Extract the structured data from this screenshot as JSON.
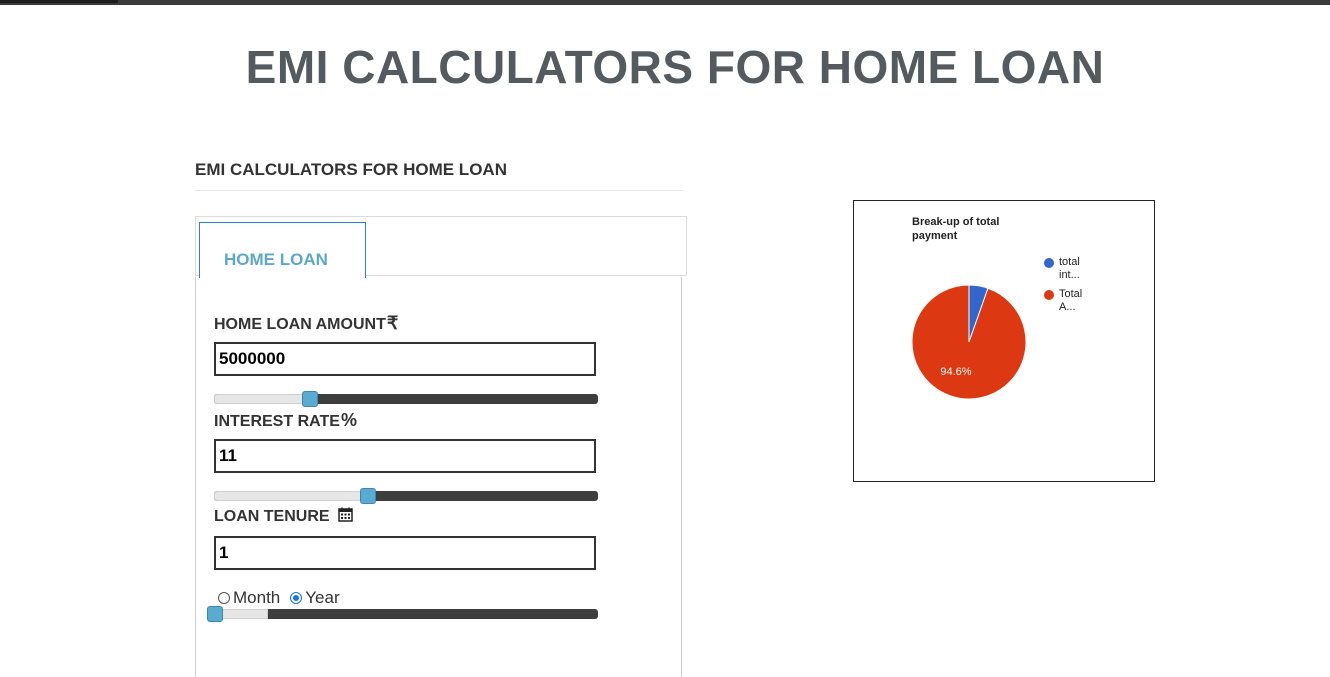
{
  "header": {
    "title": "EMI CALCULATORS FOR HOME LOAN"
  },
  "section": {
    "title": "EMI CALCULATORS FOR HOME LOAN"
  },
  "tabs": [
    {
      "label": "HOME LOAN",
      "active": true
    }
  ],
  "form": {
    "amount": {
      "label": "HOME LOAN AMOUNT",
      "symbol": "₹",
      "value": "5000000",
      "slider_fraction": 0.25
    },
    "rate": {
      "label": "INTEREST RATE",
      "symbol": "%",
      "value": "11",
      "slider_fraction": 0.4
    },
    "tenure": {
      "label": "LOAN TENURE",
      "icon": "calendar-icon",
      "value": "1",
      "slider_fraction": 0.0,
      "units": [
        {
          "label": "Month",
          "checked": false
        },
        {
          "label": "Year",
          "checked": true
        }
      ]
    }
  },
  "colors": {
    "accent": "#5ea8c7",
    "slider_thumb": "#5aabd2",
    "interest": "#3366cc",
    "principal": "#dc3912"
  },
  "chart_data": {
    "type": "pie",
    "title": "Break-up of total payment",
    "slices": [
      {
        "name": "total int...",
        "value": 5.4,
        "color": "#3366cc"
      },
      {
        "name": "Total A...",
        "value": 94.6,
        "color": "#dc3912"
      }
    ],
    "slice_labels": [
      "94.6%"
    ],
    "legend_position": "right"
  }
}
